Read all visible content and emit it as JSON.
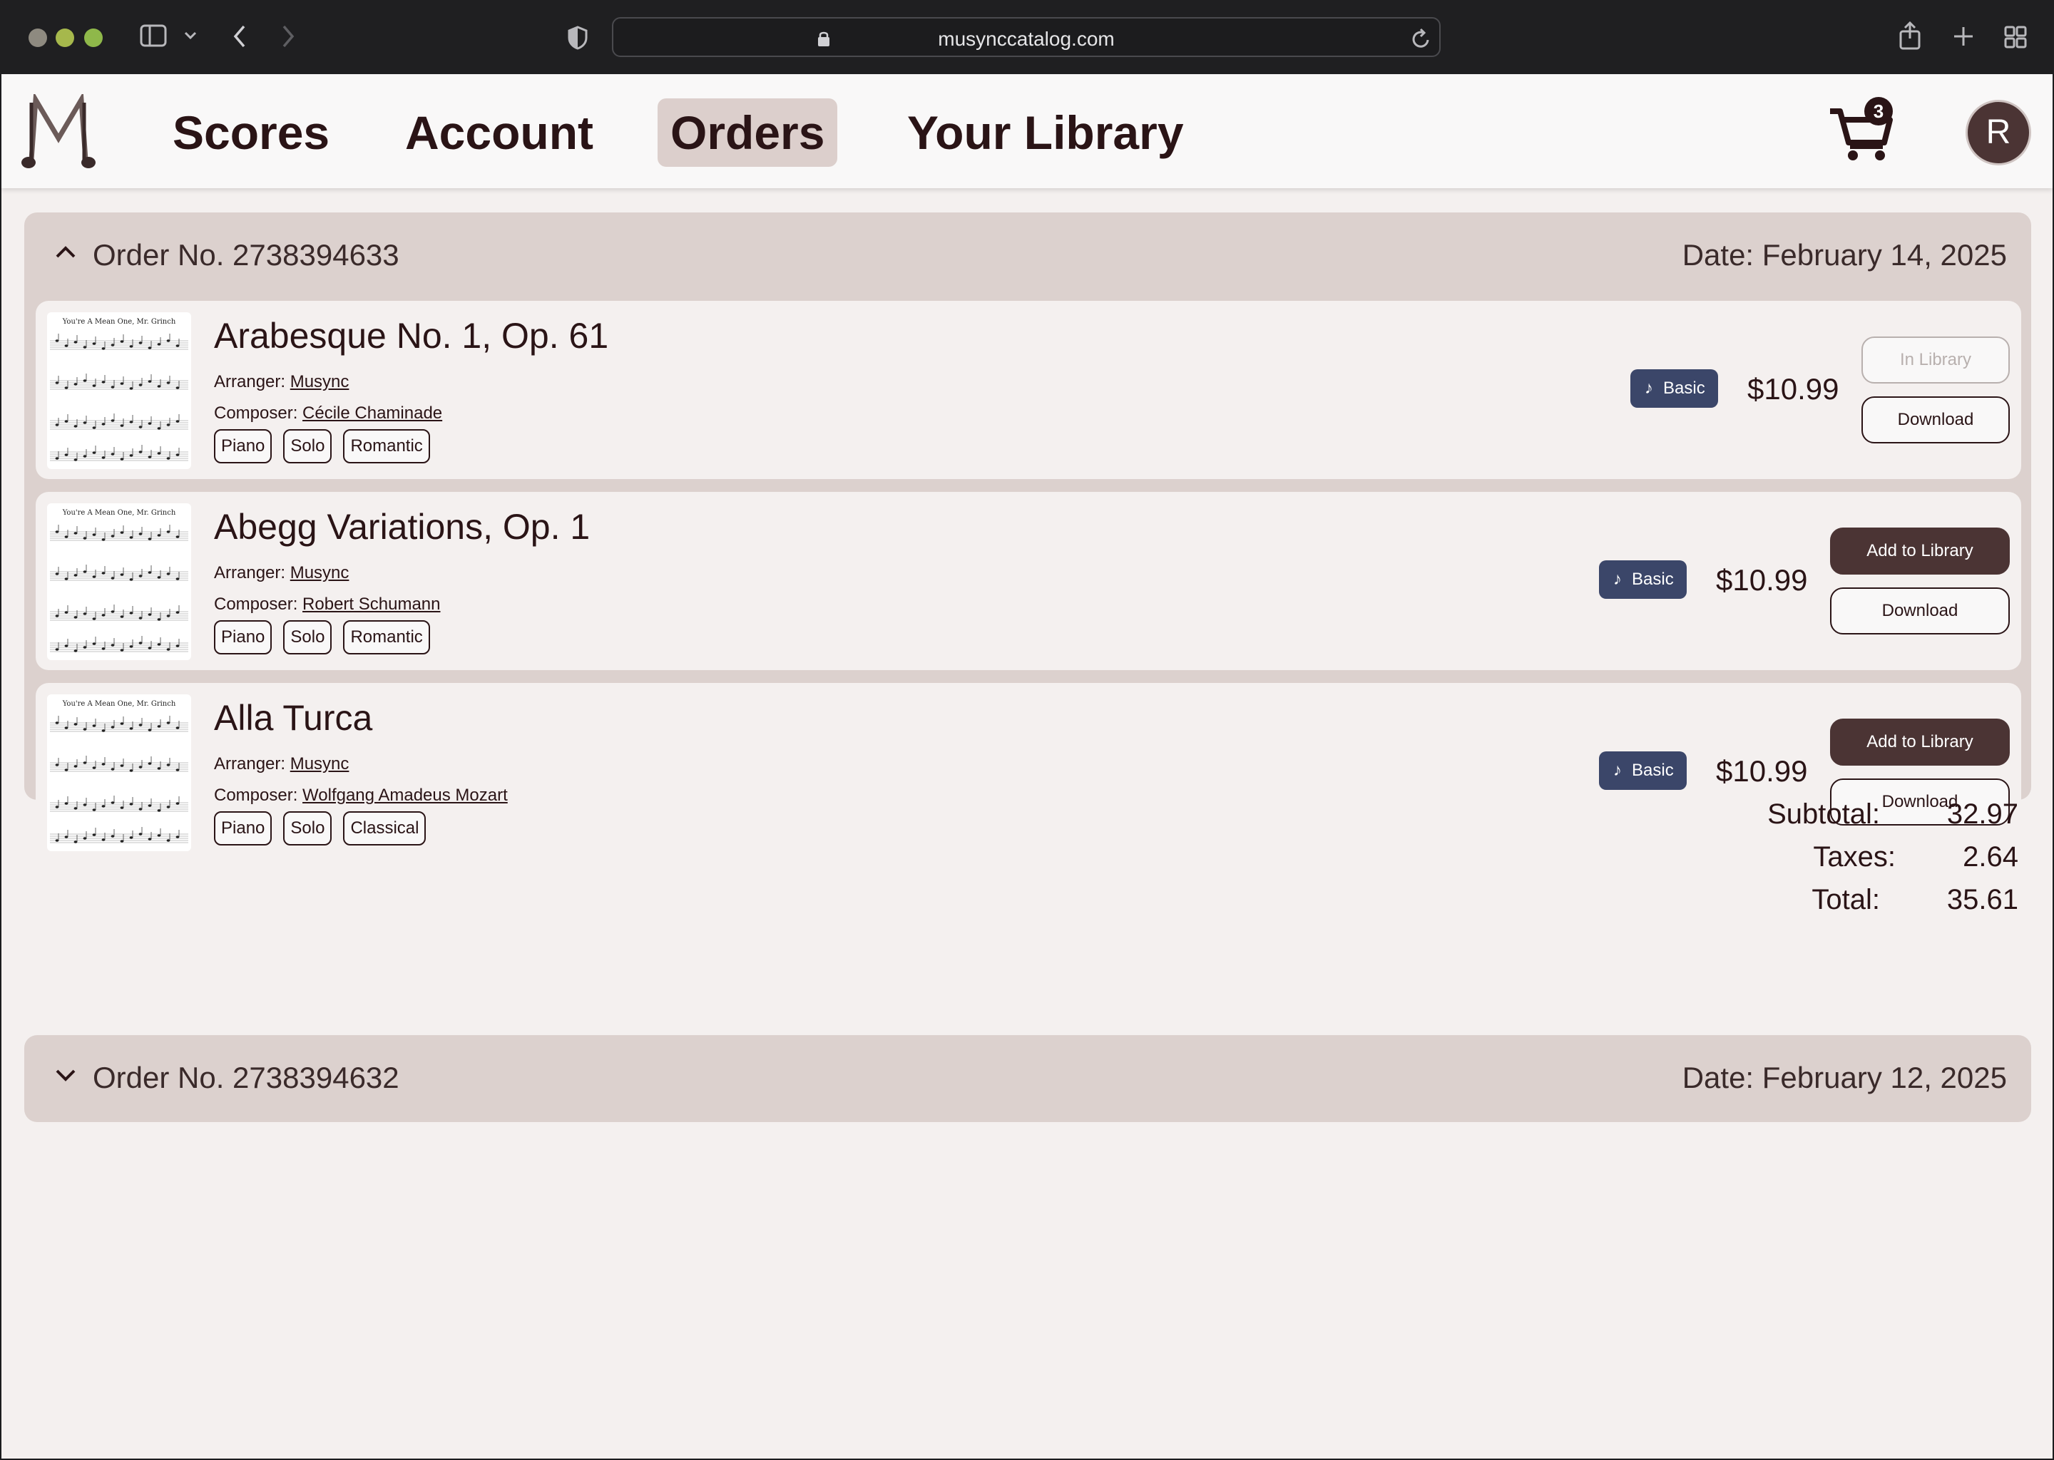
{
  "browser": {
    "url": "musynccatalog.com"
  },
  "nav": {
    "items": [
      {
        "label": "Scores"
      },
      {
        "label": "Account"
      },
      {
        "label": "Orders"
      },
      {
        "label": "Your Library"
      }
    ],
    "active": "Orders",
    "cart_count": "3",
    "avatar_initial": "R"
  },
  "orders": [
    {
      "title": "Order No. 2738394633",
      "date": "Date: February 14, 2025",
      "expanded": true,
      "items": [
        {
          "title": "Arabesque No. 1, Op. 61",
          "arranger_label": "Arranger:",
          "arranger": "Musync",
          "composer_label": "Composer:",
          "composer": "Cécile Chaminade",
          "tags": [
            "Piano",
            "Solo",
            "Romantic"
          ],
          "badge": "Basic",
          "price": "$10.99",
          "library_button": "In Library",
          "library_state": "in-library",
          "download_button": "Download"
        },
        {
          "title": "Abegg Variations, Op. 1",
          "arranger_label": "Arranger:",
          "arranger": "Musync",
          "composer_label": "Composer:",
          "composer": "Robert Schumann",
          "tags": [
            "Piano",
            "Solo",
            "Romantic"
          ],
          "badge": "Basic",
          "price": "$10.99",
          "library_button": "Add to Library",
          "library_state": "add",
          "download_button": "Download"
        },
        {
          "title": "Alla Turca",
          "arranger_label": "Arranger:",
          "arranger": "Musync",
          "composer_label": "Composer:",
          "composer": "Wolfgang Amadeus Mozart",
          "tags": [
            "Piano",
            "Solo",
            "Classical"
          ],
          "badge": "Basic",
          "price": "$10.99",
          "library_button": "Add to Library",
          "library_state": "add",
          "download_button": "Download"
        }
      ],
      "totals": {
        "subtotal_label": "Subtotal:",
        "subtotal": "32.97",
        "taxes_label": "Taxes:",
        "taxes": "2.64",
        "total_label": "Total:",
        "total": "35.61"
      }
    },
    {
      "title": "Order No. 2738394632",
      "date": "Date: February 12, 2025",
      "expanded": false
    }
  ],
  "thumbnail": {
    "heading": "You're A Mean One, Mr. Grinch"
  },
  "colors": {
    "brand_dark": "#4b3434",
    "panel": "#dcd1ce",
    "card": "#f4f0ef",
    "badge": "#3b4669",
    "text": "#2a1416"
  }
}
